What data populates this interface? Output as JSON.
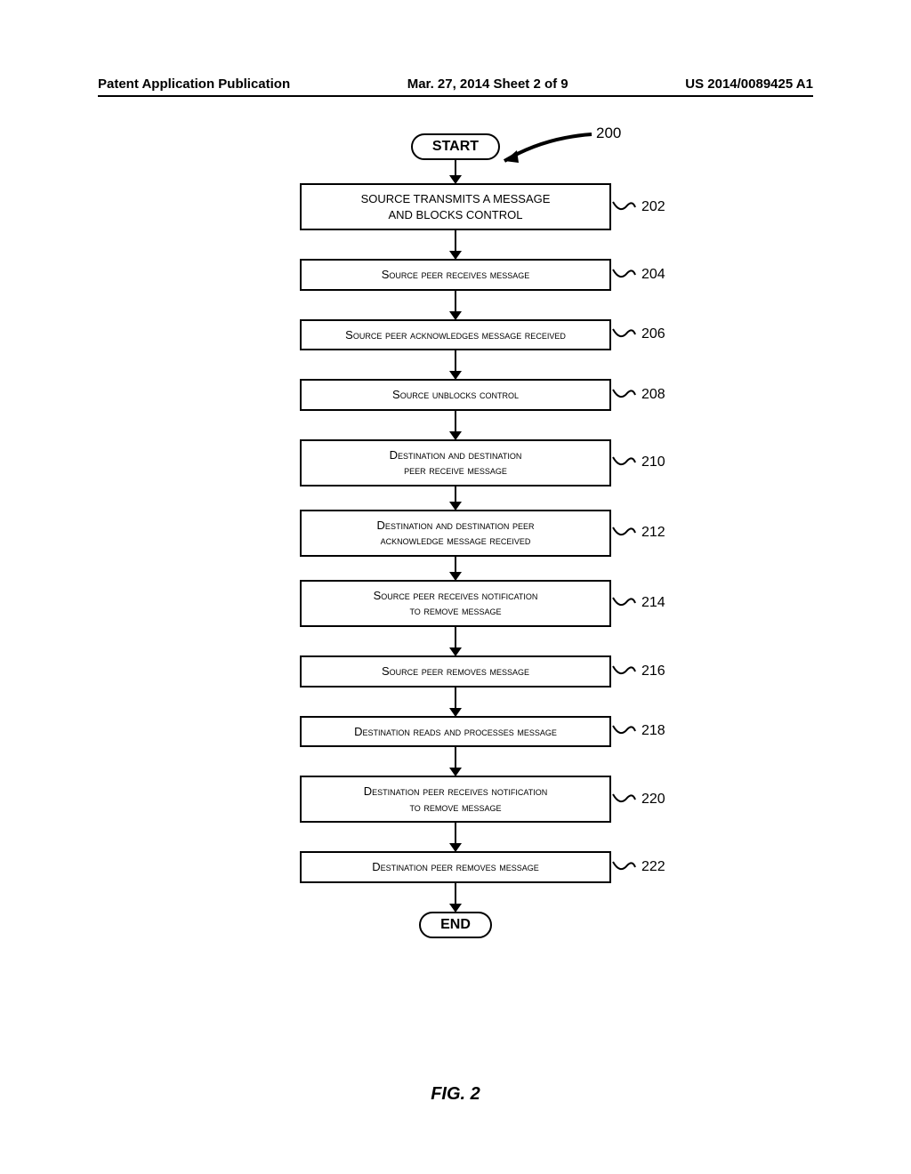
{
  "header": {
    "left": "Patent Application Publication",
    "center": "Mar. 27, 2014  Sheet 2 of 9",
    "right": "US 2014/0089425 A1"
  },
  "figure_ref": "200",
  "terminals": {
    "start": "START",
    "end": "END"
  },
  "steps": [
    {
      "ref": "202",
      "text_l1": "SOURCE TRANSMITS A MESSAGE",
      "text_l2": "AND BLOCKS CONTROL"
    },
    {
      "ref": "204",
      "text_l1": "Source peer receives message",
      "text_l2": ""
    },
    {
      "ref": "206",
      "text_l1": "Source peer acknowledges message received",
      "text_l2": ""
    },
    {
      "ref": "208",
      "text_l1": "Source unblocks control",
      "text_l2": ""
    },
    {
      "ref": "210",
      "text_l1": "Destination and destination",
      "text_l2": "peer receive message"
    },
    {
      "ref": "212",
      "text_l1": "Destination and destination peer",
      "text_l2": "acknowledge message received"
    },
    {
      "ref": "214",
      "text_l1": "Source peer receives notification",
      "text_l2": "to remove message"
    },
    {
      "ref": "216",
      "text_l1": "Source peer removes message",
      "text_l2": ""
    },
    {
      "ref": "218",
      "text_l1": "Destination reads and processes message",
      "text_l2": ""
    },
    {
      "ref": "220",
      "text_l1": "Destination peer receives notification",
      "text_l2": "to remove message"
    },
    {
      "ref": "222",
      "text_l1": "Destination peer removes message",
      "text_l2": ""
    }
  ],
  "caption": "FIG. 2"
}
